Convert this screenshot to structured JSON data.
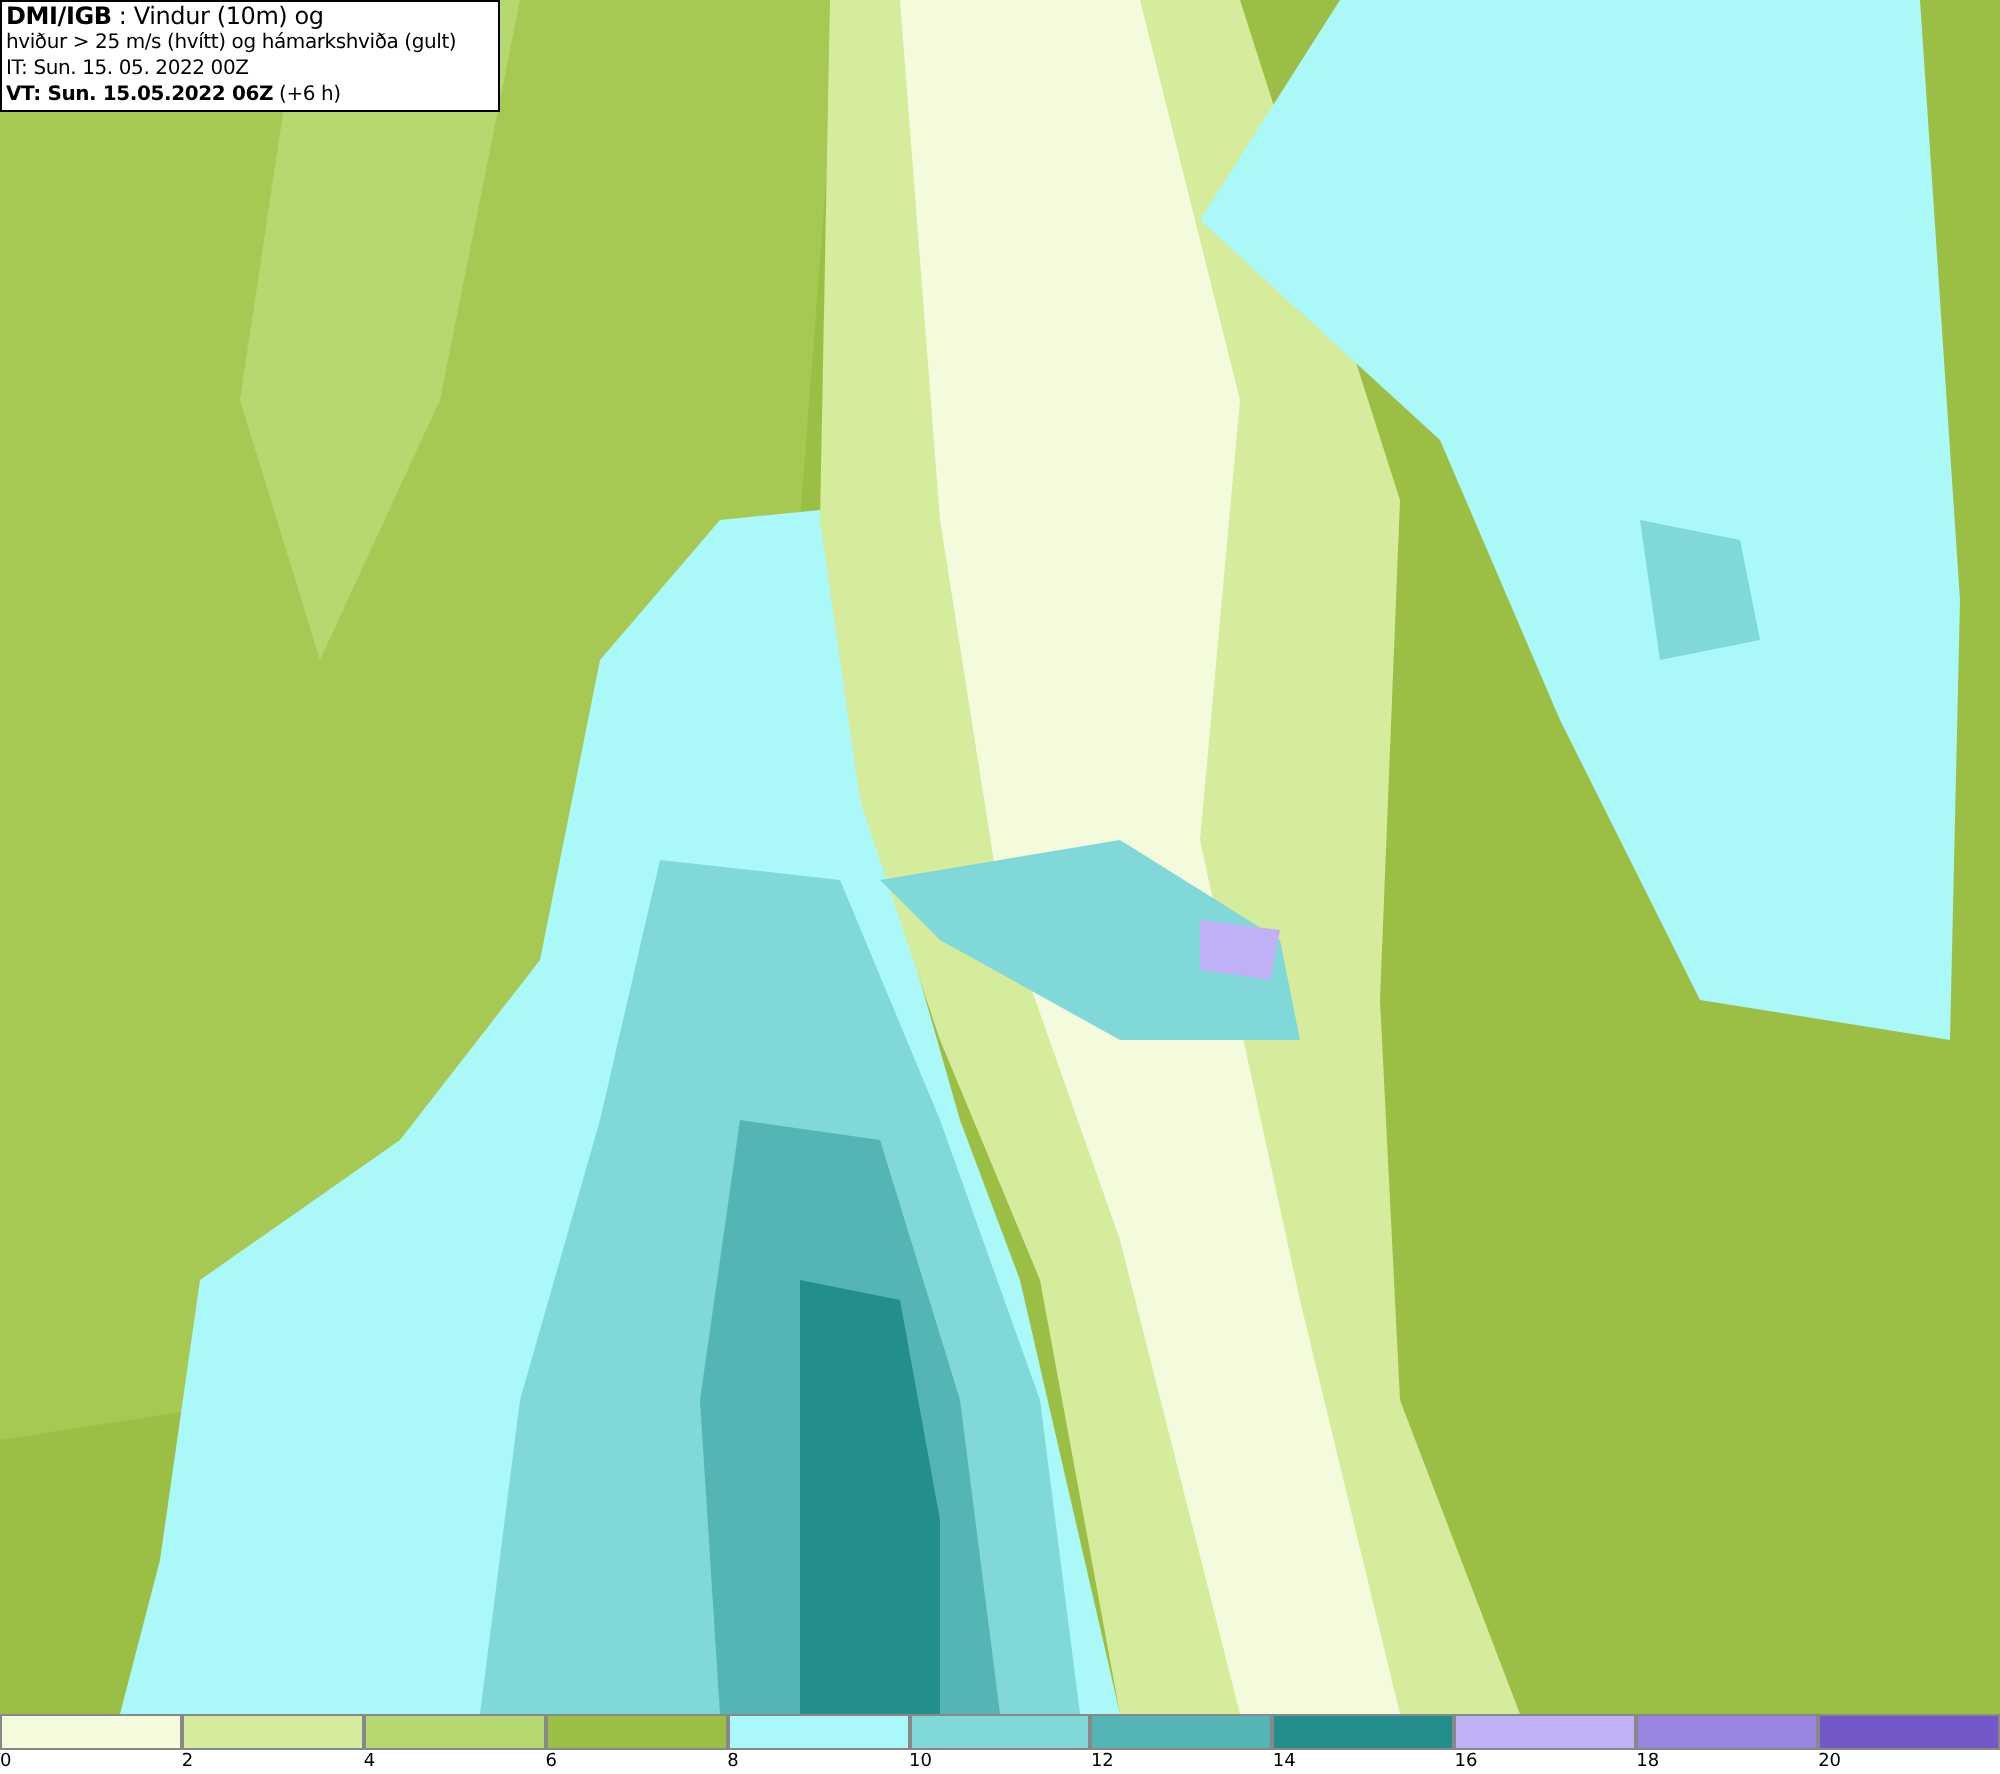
{
  "header": {
    "lines": [
      "**DMI/IGB** : Vindur (10m) og",
      "hviður > 25 m/s (hvítt) og hámarkshviða (gult)",
      "IT: Sun. 15. 05. 2022 00Z",
      "**VT: Sun. 15.05.2022 06Z** (+6 h)"
    ]
  },
  "legend": {
    "bins": [
      {
        "color": "#f3fbdc"
      },
      {
        "color": "#d4ec9c"
      },
      {
        "color": "#b5d870"
      },
      {
        "color": "#9abf44"
      },
      {
        "color": "#aaf8f8"
      },
      {
        "color": "#80d8d8"
      },
      {
        "color": "#55b4b4"
      },
      {
        "color": "#228f8c"
      },
      {
        "color": "#c0b0f5"
      },
      {
        "color": "#9a86e0"
      },
      {
        "color": "#7258c8"
      }
    ],
    "labels": [
      "0",
      "2",
      "4",
      "6",
      "8",
      "10",
      "12",
      "14",
      "16",
      "18",
      "20"
    ]
  }
}
